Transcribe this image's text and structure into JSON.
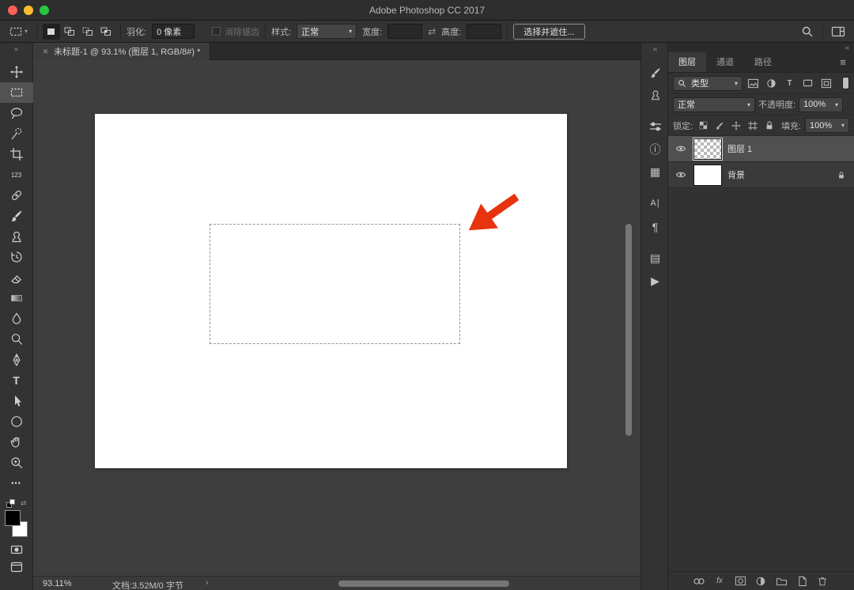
{
  "titlebar": {
    "title": "Adobe Photoshop CC 2017"
  },
  "glyphs": {
    "dropdown": "▾",
    "double_left": "«",
    "double_right": "»",
    "close": "×",
    "menu": "≡",
    "swap": "⇄",
    "more": "•••",
    "info": "ⓘ",
    "histogram": "▦",
    "character": "A|",
    "paragraph": "¶",
    "layer_comps": "▤",
    "play": "▶",
    "chevron": "›",
    "count": "123",
    "type": "T",
    "fx": "fx"
  },
  "options_bar": {
    "feather_label": "羽化:",
    "feather_value": "0 像素",
    "antialias_label": "消除锯齿",
    "style_label": "样式:",
    "style_value": "正常",
    "width_label": "宽度:",
    "width_value": "",
    "height_label": "高度:",
    "height_value": "",
    "select_and_mask_label": "选择并遮住..."
  },
  "document_tab": {
    "title": "未标题-1 @ 93.1% (图层 1, RGB/8#) *"
  },
  "layers_panel": {
    "tabs": [
      {
        "label": "图层"
      },
      {
        "label": "通道"
      },
      {
        "label": "路径"
      }
    ],
    "filter_kind": "类型",
    "blend_mode": "正常",
    "opacity_label": "不透明度:",
    "opacity_value": "100%",
    "lock_label": "锁定:",
    "fill_label": "填充:",
    "fill_value": "100%",
    "layers": [
      {
        "name": "图层 1"
      },
      {
        "name": "背景"
      }
    ]
  },
  "status_bar": {
    "zoom": "93.11%",
    "doc_info": "文档:3.52M/0 字节"
  },
  "colors": {
    "arrow_red": "#e8330f",
    "traffic_red": "#ff5f57",
    "traffic_yellow": "#febc2e",
    "traffic_green": "#28c840",
    "selection_dash": "#949494"
  }
}
